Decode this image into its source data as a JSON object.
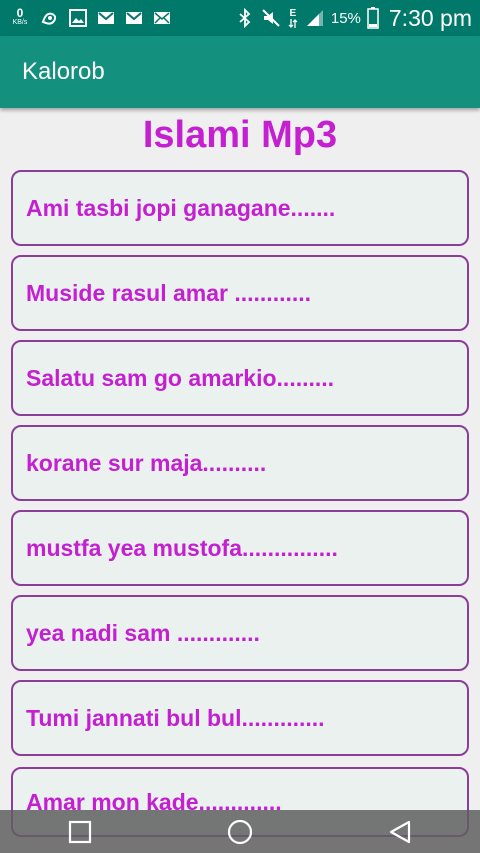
{
  "status_bar": {
    "data_speed_value": "0",
    "data_speed_unit": "KB/s",
    "battery_percent": "15%",
    "time": "7:30 pm",
    "network_type": "E",
    "icons": [
      "data-speed",
      "game-icon",
      "image-icon",
      "gmail-icon",
      "gmail-icon",
      "mail-icon",
      "bluetooth-icon",
      "mute-icon",
      "network-icon",
      "signal-icon",
      "battery-icon"
    ]
  },
  "app_bar": {
    "title": "Kalorob"
  },
  "page": {
    "heading": "Islami Mp3"
  },
  "songs": [
    {
      "label": "Ami tasbi jopi ganagane......."
    },
    {
      "label": "Muside rasul amar ............"
    },
    {
      "label": "Salatu sam go amarkio........."
    },
    {
      "label": "korane sur maja.........."
    },
    {
      "label": "mustfa yea mustofa..............."
    },
    {
      "label": "yea nadi sam ............."
    },
    {
      "label": " Tumi jannati bul bul............."
    },
    {
      "label": " Amar mon kade............."
    }
  ],
  "nav_bar": {
    "buttons": [
      "recents-button",
      "home-button",
      "back-button"
    ]
  },
  "colors": {
    "status_bar": "#00796b",
    "app_bar": "#14907f",
    "accent_text": "#c41fd1",
    "item_border": "#8b3d9a",
    "item_background": "#eaf1ee",
    "page_background": "#efefef"
  }
}
